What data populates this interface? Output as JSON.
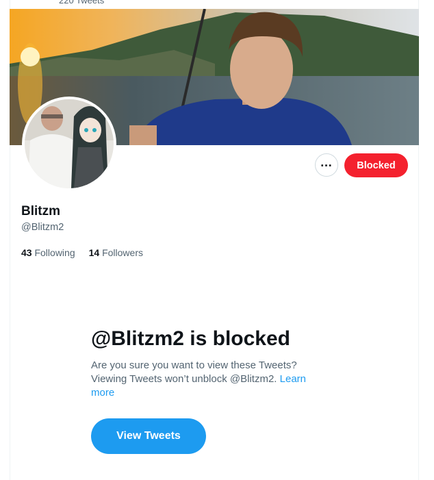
{
  "header": {
    "tweet_count": "220 Tweets"
  },
  "profile": {
    "name": "Blitzm",
    "handle": "@Blitzm2",
    "following_count": "43",
    "following_label": "Following",
    "followers_count": "14",
    "followers_label": "Followers"
  },
  "actions": {
    "more_icon": "more-horizontal-icon",
    "blocked_label": "Blocked"
  },
  "blocked_notice": {
    "title": "@Blitzm2 is blocked",
    "message": "Are you sure you want to view these Tweets? Viewing Tweets won’t unblock @Blitzm2.",
    "learn_more": "Learn more",
    "view_button": "View Tweets"
  },
  "colors": {
    "accent": "#1d9bf0",
    "blocked": "#f4212e",
    "text": "#0f1419",
    "secondary": "#536471"
  }
}
